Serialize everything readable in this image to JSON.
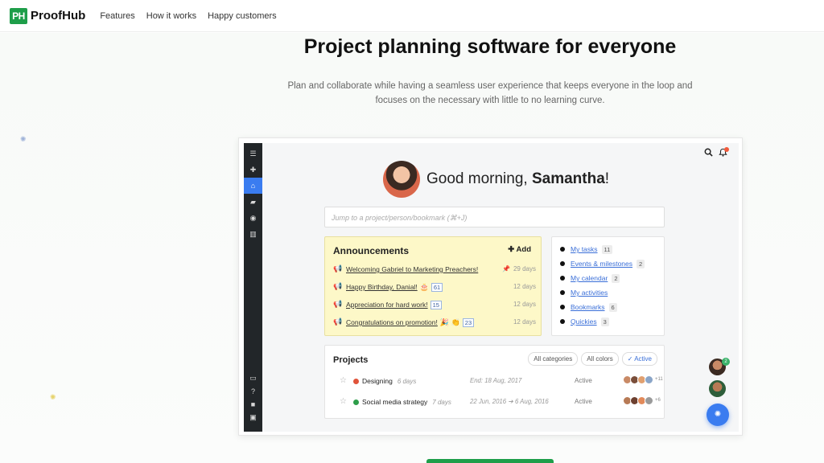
{
  "nav": {
    "logo_mark": "PH",
    "brand": "ProofHub",
    "links": [
      "Features",
      "How it works",
      "Happy customers"
    ]
  },
  "hero": {
    "title": "Project planning software for everyone",
    "subtitle": "Plan and collaborate while having a seamless user experience that keeps everyone in the loop and focuses on the necessary with little to no learning curve."
  },
  "app": {
    "greeting_prefix": "Good morning, ",
    "greeting_name": "Samantha",
    "greeting_suffix": "!",
    "jump_placeholder": "Jump to a project/person/bookmark (⌘+J)",
    "announcements": {
      "title": "Announcements",
      "add_label": "Add",
      "items": [
        {
          "text": "Welcoming Gabriel to Marketing Preachers!",
          "emoji": "",
          "count": "",
          "days": "29 days",
          "pinned": true
        },
        {
          "text": "Happy Birthday, Danial!",
          "emoji": "🎂",
          "count": "61",
          "days": "12 days",
          "pinned": false
        },
        {
          "text": "Appreciation for hard work!",
          "emoji": "",
          "count": "15",
          "days": "12 days",
          "pinned": false
        },
        {
          "text": "Congratulations on promotion!",
          "emoji": "🎉 👏",
          "count": "23",
          "days": "12 days",
          "pinned": false
        }
      ]
    },
    "quick_links": [
      {
        "label": "My tasks",
        "count": "11"
      },
      {
        "label": "Events & milestones",
        "count": "2"
      },
      {
        "label": "My calendar",
        "count": "2"
      },
      {
        "label": "My activities",
        "count": ""
      },
      {
        "label": "Bookmarks",
        "count": "6"
      },
      {
        "label": "Quickies",
        "count": "3"
      }
    ],
    "projects": {
      "title": "Projects",
      "filters": [
        "All categories",
        "All colors",
        "✓ Active"
      ],
      "rows": [
        {
          "name": "Designing",
          "days": "6 days",
          "date": "End: 18 Aug, 2017",
          "status": "Active",
          "dot_color": "#e0533a",
          "more": "+11"
        },
        {
          "name": "Social media strategy",
          "days": "7 days",
          "date": "22 Jun, 2016 ➔ 6 Aug, 2016",
          "status": "Active",
          "dot_color": "#2e9e4a",
          "more": "+6"
        }
      ]
    },
    "float_badge": "2"
  },
  "colors": {
    "brand_green": "#1e9e4a",
    "accent_blue": "#3a7cf0",
    "announcement_bg": "#fdf8c8"
  }
}
